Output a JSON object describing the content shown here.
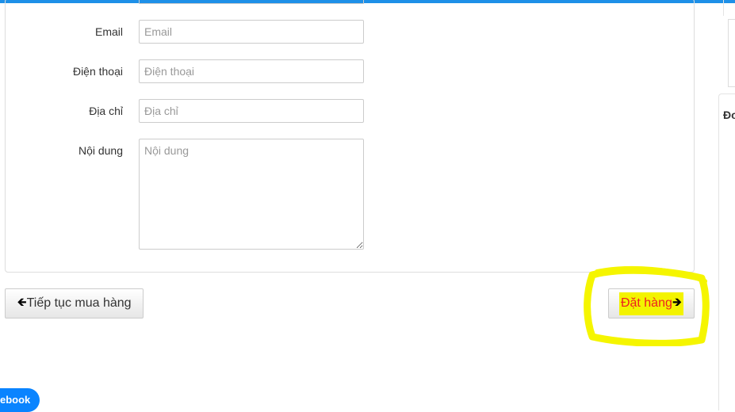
{
  "form": {
    "email": {
      "label": "Email",
      "placeholder": "Email",
      "value": ""
    },
    "phone": {
      "label": "Điện thoại",
      "placeholder": "Điện thoại",
      "value": ""
    },
    "address": {
      "label": "Địa chỉ",
      "placeholder": "Địa chỉ",
      "value": ""
    },
    "content": {
      "label": "Nội dung",
      "placeholder": "Nội dung",
      "value": ""
    }
  },
  "actions": {
    "continue_shopping_label": "Tiếp tục mua hàng",
    "continue_icon": "arrow-left-icon",
    "place_order_label": "Đặt hàng",
    "place_order_icon": "arrow-right-icon"
  },
  "sidebar": {
    "title_partial": "Đơ"
  },
  "chat_widget": {
    "label_partial": "ebook"
  },
  "colors": {
    "accent": "#1e90e8",
    "highlight_marker": "#f5f500",
    "order_text": "#ee2020",
    "messenger": "#0a84ff"
  }
}
